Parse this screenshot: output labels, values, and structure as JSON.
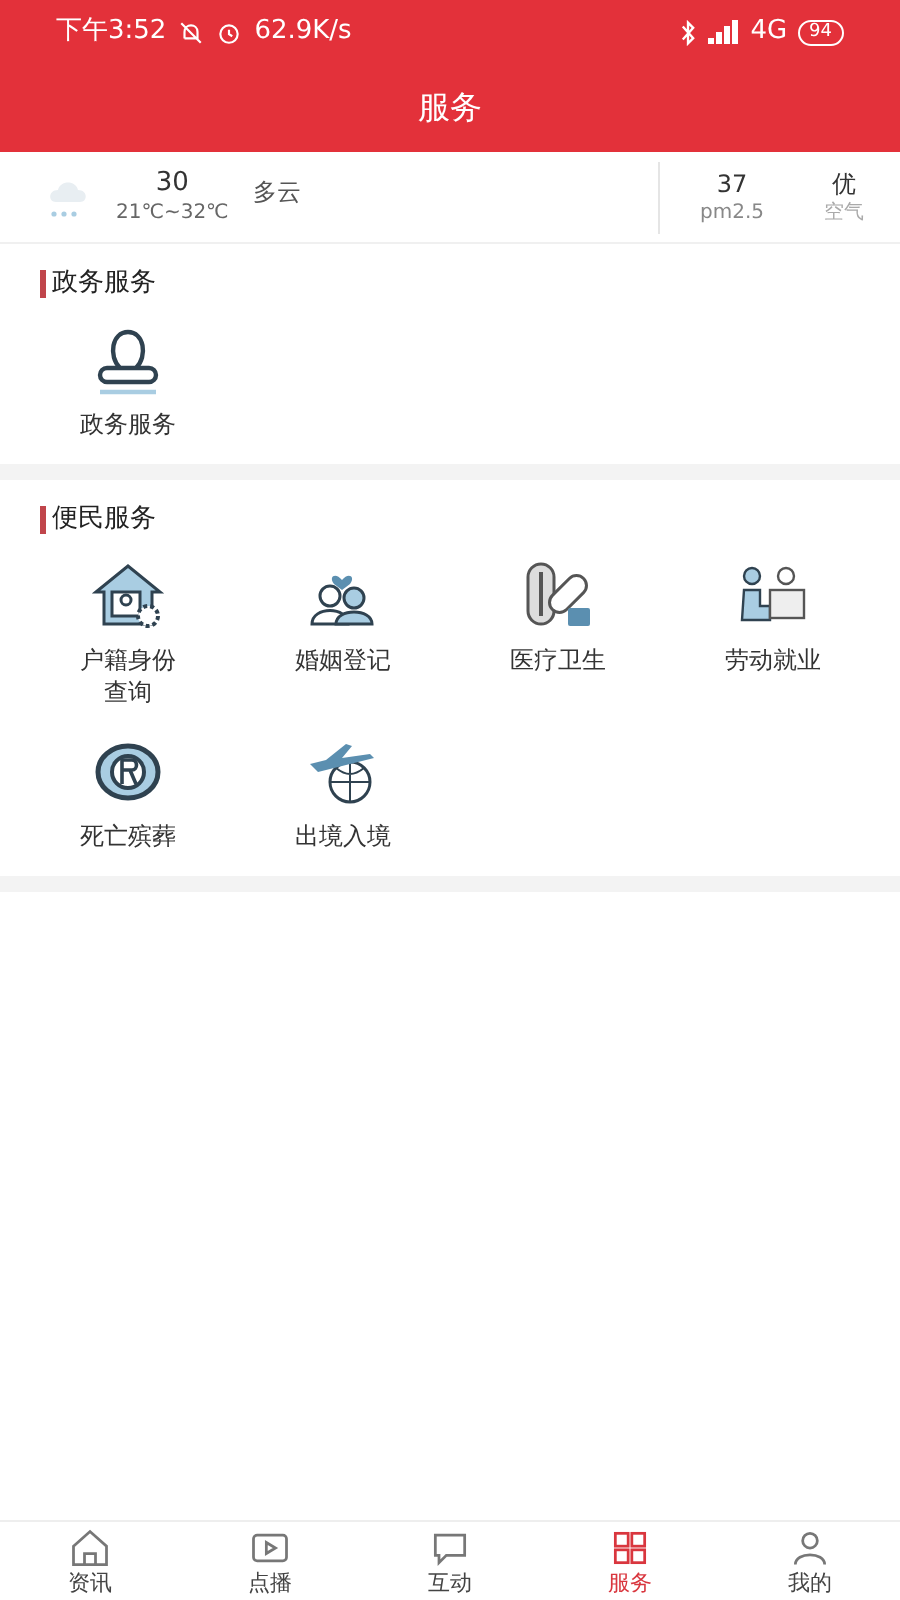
{
  "status_bar": {
    "time": "下午3:52",
    "speed": "62.9K/s",
    "network": "4G",
    "battery": "94"
  },
  "header": {
    "title": "服务"
  },
  "weather": {
    "temperature": "30",
    "range": "21℃~32℃",
    "condition": "多云",
    "pm25_value": "37",
    "pm25_label": "pm2.5",
    "air_value": "优",
    "air_label": "空气"
  },
  "sections": [
    {
      "title": "政务服务",
      "items": [
        {
          "label": "政务服务"
        }
      ]
    },
    {
      "title": "便民服务",
      "items": [
        {
          "label": "户籍身份查询"
        },
        {
          "label": "婚姻登记"
        },
        {
          "label": "医疗卫生"
        },
        {
          "label": "劳动就业"
        },
        {
          "label": "死亡殡葬"
        },
        {
          "label": "出境入境"
        }
      ]
    }
  ],
  "tabs": [
    {
      "label": "资讯",
      "selected": false
    },
    {
      "label": "点播",
      "selected": false
    },
    {
      "label": "互动",
      "selected": false
    },
    {
      "label": "服务",
      "selected": true
    },
    {
      "label": "我的",
      "selected": false
    }
  ]
}
